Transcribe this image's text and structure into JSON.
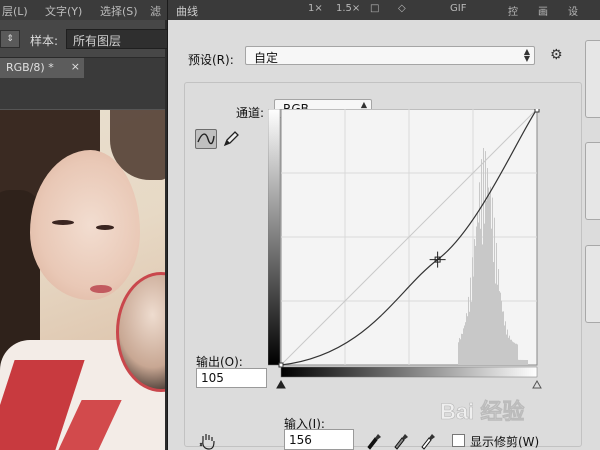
{
  "ps": {
    "menu": [
      "层(L)",
      "文字(Y)",
      "选择(S)",
      "滤"
    ],
    "sample_label": "样本:",
    "sample_value": "所有图层",
    "doc_tab_label": "RGB/8) *",
    "doc_tab_close": "×"
  },
  "dialog": {
    "title": "曲线",
    "top_icons": [
      "1×",
      "1.5×",
      "□",
      "◇",
      "GIF",
      "控",
      "画",
      "设"
    ],
    "preset_label": "预设(R):",
    "preset_value": "自定",
    "channel_label": "通道:",
    "channel_value": "RGB",
    "output_label": "输出(O):",
    "output_value": "105",
    "input_label": "输入(I):",
    "input_value": "156",
    "show_clipping_label": "显示修剪(W)",
    "show_clipping_checked": false,
    "control_point": {
      "input": 156,
      "output": 105
    }
  },
  "watermark": {
    "text": "Bai 经验"
  },
  "colors": {
    "dialog_bg": "#dcdcdc",
    "graph_bg": "#f4f4f4",
    "curve": "#333333",
    "histogram": "#c8c8c8"
  }
}
